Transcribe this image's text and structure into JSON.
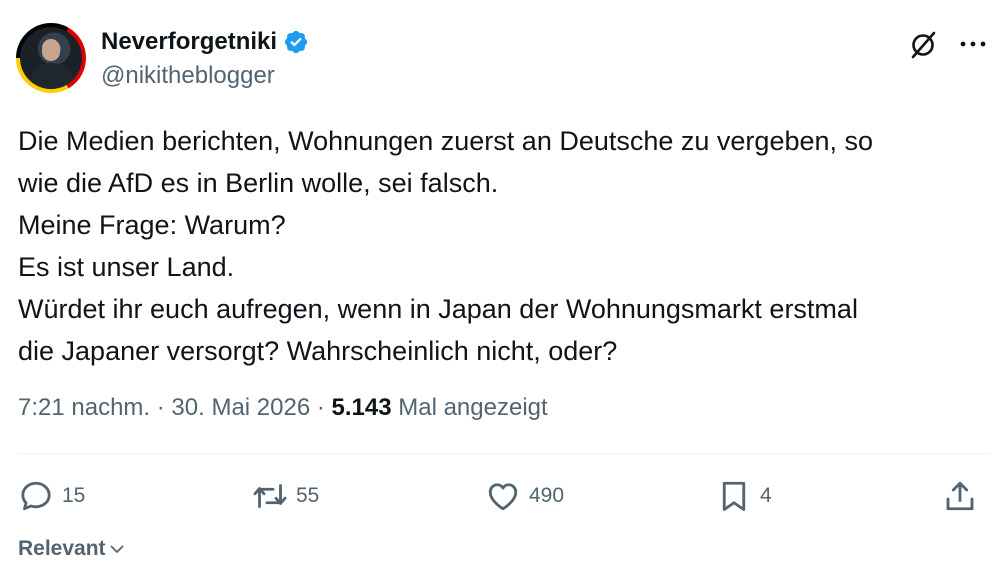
{
  "author": {
    "name": "Neverforgetniki",
    "handle": "@nikitheblogger",
    "verified": true,
    "verified_color": "#1d9bf0"
  },
  "tweet": {
    "lines": [
      "Die Medien berichten, Wohnungen zuerst an Deutsche zu vergeben, so",
      "wie die AfD es in Berlin wolle, sei falsch.",
      "Meine Frage: Warum?",
      "Es ist unser Land.",
      "Würdet ihr euch aufregen, wenn in Japan der Wohnungsmarkt erstmal",
      "die Japaner versorgt? Wahrscheinlich nicht, oder?"
    ]
  },
  "meta": {
    "time": "7:21 nachm.",
    "sep1": " · ",
    "date": "30. Mai 2026",
    "sep2": " · ",
    "views": "5.143",
    "views_label": " Mal angezeigt"
  },
  "actions": {
    "replies": "15",
    "retweets": "55",
    "likes": "490",
    "bookmarks": "4"
  },
  "icons": [
    "grok-icon",
    "more-icon",
    "reply-icon",
    "retweet-icon",
    "like-icon",
    "bookmark-icon",
    "share-icon",
    "chevron-down-icon",
    "verified-badge-icon"
  ],
  "sort": {
    "label": "Relevant"
  }
}
